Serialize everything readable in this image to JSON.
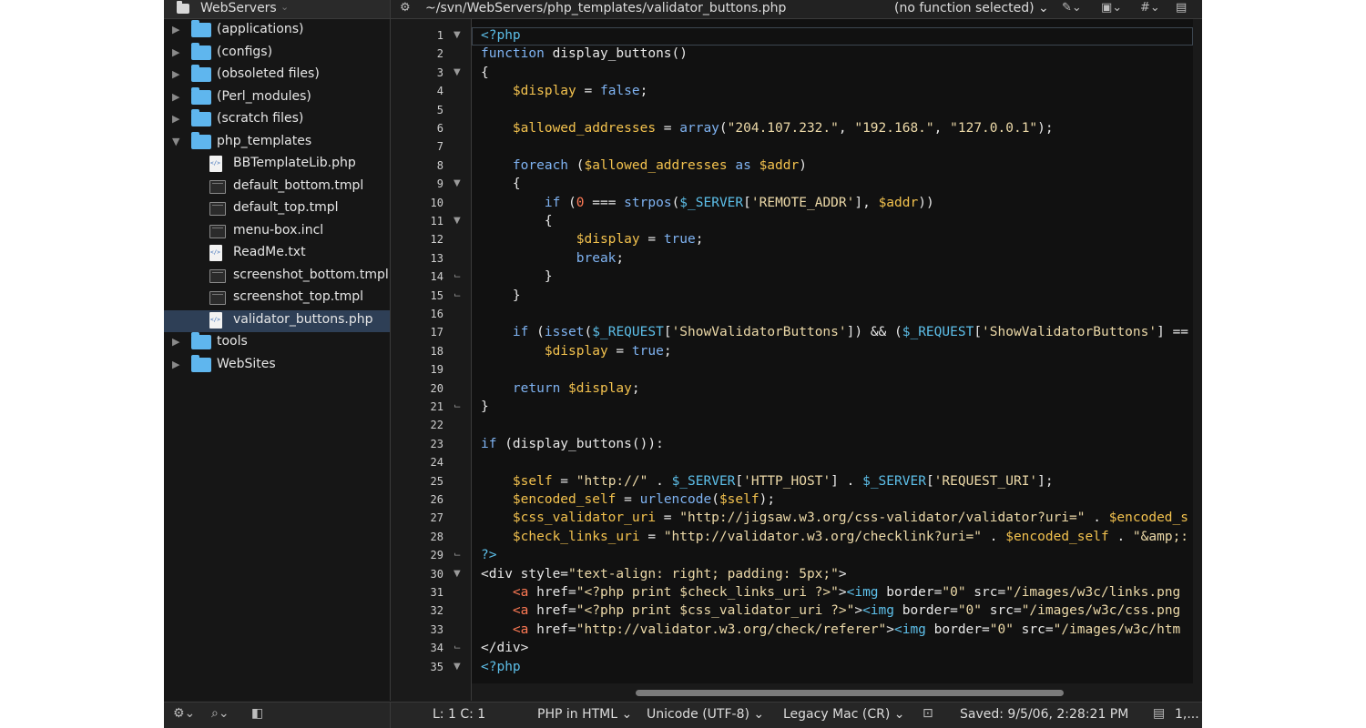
{
  "sidebar": {
    "title": "WebServers",
    "items": [
      {
        "label": "(applications)",
        "kind": "folder",
        "expanded": false,
        "depth": 0
      },
      {
        "label": "(configs)",
        "kind": "folder",
        "expanded": false,
        "depth": 0
      },
      {
        "label": "(obsoleted files)",
        "kind": "folder",
        "expanded": false,
        "depth": 0
      },
      {
        "label": "(Perl_modules)",
        "kind": "folder",
        "expanded": false,
        "depth": 0
      },
      {
        "label": "(scratch files)",
        "kind": "folder",
        "expanded": false,
        "depth": 0
      },
      {
        "label": "php_templates",
        "kind": "folder",
        "expanded": true,
        "depth": 0
      },
      {
        "label": "BBTemplateLib.php",
        "kind": "doc",
        "depth": 1
      },
      {
        "label": "default_bottom.tmpl",
        "kind": "term",
        "depth": 1
      },
      {
        "label": "default_top.tmpl",
        "kind": "term",
        "depth": 1
      },
      {
        "label": "menu-box.incl",
        "kind": "term",
        "depth": 1
      },
      {
        "label": "ReadMe.txt",
        "kind": "doc",
        "depth": 1
      },
      {
        "label": "screenshot_bottom.tmpl",
        "kind": "term",
        "depth": 1
      },
      {
        "label": "screenshot_top.tmpl",
        "kind": "term",
        "depth": 1
      },
      {
        "label": "validator_buttons.php",
        "kind": "doc",
        "depth": 1,
        "selected": true
      },
      {
        "label": "tools",
        "kind": "folder",
        "expanded": false,
        "depth": 0
      },
      {
        "label": "WebSites",
        "kind": "folder",
        "expanded": false,
        "depth": 0
      }
    ]
  },
  "pathbar": {
    "path": "~/svn/WebServers/php_templates/validator_buttons.php",
    "function_menu": "(no function selected) ⌄"
  },
  "editor": {
    "fold_markers": {
      "1": "down",
      "3": "down",
      "9": "down",
      "11": "down",
      "14": "end",
      "15": "end",
      "21": "end",
      "29": "end",
      "30": "down",
      "34": "end",
      "35": "down"
    },
    "lines": [
      [
        [
          "<?php",
          "ph"
        ]
      ],
      [
        [
          "function ",
          "k"
        ],
        [
          "display_buttons()",
          ""
        ]
      ],
      [
        [
          "{",
          ""
        ]
      ],
      [
        [
          "    ",
          ""
        ],
        [
          "$display",
          "v"
        ],
        [
          " = ",
          ""
        ],
        [
          "false",
          "k"
        ],
        [
          ";",
          ""
        ]
      ],
      [],
      [
        [
          "    ",
          ""
        ],
        [
          "$allowed_addresses",
          "v"
        ],
        [
          " = ",
          ""
        ],
        [
          "array",
          "k"
        ],
        [
          "(",
          ""
        ],
        [
          "\"204.107.232.\"",
          "s"
        ],
        [
          ", ",
          ""
        ],
        [
          "\"192.168.\"",
          "s"
        ],
        [
          ", ",
          ""
        ],
        [
          "\"127.0.0.1\"",
          "s"
        ],
        [
          ");",
          ""
        ]
      ],
      [],
      [
        [
          "    ",
          ""
        ],
        [
          "foreach",
          "k"
        ],
        [
          " (",
          ""
        ],
        [
          "$allowed_addresses",
          "v"
        ],
        [
          " ",
          ""
        ],
        [
          "as",
          "k"
        ],
        [
          " ",
          ""
        ],
        [
          "$addr",
          "v"
        ],
        [
          ")",
          ""
        ]
      ],
      [
        [
          "    {",
          ""
        ]
      ],
      [
        [
          "        ",
          ""
        ],
        [
          "if",
          "k"
        ],
        [
          " (",
          ""
        ],
        [
          "0",
          "n"
        ],
        [
          " === ",
          ""
        ],
        [
          "strpos",
          "k"
        ],
        [
          "(",
          ""
        ],
        [
          "$_SERVER",
          "c"
        ],
        [
          "[",
          ""
        ],
        [
          "'REMOTE_ADDR'",
          "s"
        ],
        [
          "], ",
          ""
        ],
        [
          "$addr",
          "v"
        ],
        [
          "))",
          ""
        ]
      ],
      [
        [
          "        {",
          ""
        ]
      ],
      [
        [
          "            ",
          ""
        ],
        [
          "$display",
          "v"
        ],
        [
          " = ",
          ""
        ],
        [
          "true",
          "k"
        ],
        [
          ";",
          ""
        ]
      ],
      [
        [
          "            ",
          ""
        ],
        [
          "break",
          "k"
        ],
        [
          ";",
          ""
        ]
      ],
      [
        [
          "        }",
          ""
        ]
      ],
      [
        [
          "    }",
          ""
        ]
      ],
      [],
      [
        [
          "    ",
          ""
        ],
        [
          "if",
          "k"
        ],
        [
          " (",
          ""
        ],
        [
          "isset",
          "k"
        ],
        [
          "(",
          ""
        ],
        [
          "$_REQUEST",
          "c"
        ],
        [
          "[",
          ""
        ],
        [
          "'ShowValidatorButtons'",
          "s"
        ],
        [
          "]) && (",
          ""
        ],
        [
          "$_REQUEST",
          "c"
        ],
        [
          "[",
          ""
        ],
        [
          "'ShowValidatorButtons'",
          "s"
        ],
        [
          "] ==",
          ""
        ]
      ],
      [
        [
          "        ",
          ""
        ],
        [
          "$display",
          "v"
        ],
        [
          " = ",
          ""
        ],
        [
          "true",
          "k"
        ],
        [
          ";",
          ""
        ]
      ],
      [],
      [
        [
          "    ",
          ""
        ],
        [
          "return",
          "k"
        ],
        [
          " ",
          ""
        ],
        [
          "$display",
          "v"
        ],
        [
          ";",
          ""
        ]
      ],
      [
        [
          "}",
          ""
        ]
      ],
      [],
      [
        [
          "if",
          "k"
        ],
        [
          " (display_buttons()):",
          ""
        ]
      ],
      [],
      [
        [
          "    ",
          ""
        ],
        [
          "$self",
          "v"
        ],
        [
          " = ",
          ""
        ],
        [
          "\"http://\"",
          "s"
        ],
        [
          " . ",
          ""
        ],
        [
          "$_SERVER",
          "c"
        ],
        [
          "[",
          ""
        ],
        [
          "'HTTP_HOST'",
          "s"
        ],
        [
          "] . ",
          ""
        ],
        [
          "$_SERVER",
          "c"
        ],
        [
          "[",
          ""
        ],
        [
          "'REQUEST_URI'",
          "s"
        ],
        [
          "];",
          ""
        ]
      ],
      [
        [
          "    ",
          ""
        ],
        [
          "$encoded_self",
          "v"
        ],
        [
          " = ",
          ""
        ],
        [
          "urlencode",
          "k"
        ],
        [
          "(",
          ""
        ],
        [
          "$self",
          "v"
        ],
        [
          ");",
          ""
        ]
      ],
      [
        [
          "    ",
          ""
        ],
        [
          "$css_validator_uri",
          "v"
        ],
        [
          " = ",
          ""
        ],
        [
          "\"http://jigsaw.w3.org/css-validator/validator?uri=\"",
          "s"
        ],
        [
          " . ",
          ""
        ],
        [
          "$encoded_s",
          "v"
        ]
      ],
      [
        [
          "    ",
          ""
        ],
        [
          "$check_links_uri",
          "v"
        ],
        [
          " = ",
          ""
        ],
        [
          "\"http://validator.w3.org/checklink?uri=\"",
          "s"
        ],
        [
          " . ",
          ""
        ],
        [
          "$encoded_self",
          "v"
        ],
        [
          " . ",
          ""
        ],
        [
          "\"&amp;:",
          "s"
        ]
      ],
      [
        [
          "?>",
          "ph"
        ]
      ],
      [
        [
          "<div ",
          ""
        ],
        [
          "style=",
          ""
        ],
        [
          "\"text-align: right; padding: 5px;\"",
          "s"
        ],
        [
          ">",
          ""
        ]
      ],
      [
        [
          "    ",
          ""
        ],
        [
          "<a",
          "t"
        ],
        [
          " href=",
          ""
        ],
        [
          "\"<?php print $check_links_uri ?>\"",
          "s"
        ],
        [
          ">",
          ""
        ],
        [
          "<img",
          "c"
        ],
        [
          " border=",
          ""
        ],
        [
          "\"0\"",
          "s"
        ],
        [
          " src=",
          ""
        ],
        [
          "\"/images/w3c/links.png",
          "s"
        ]
      ],
      [
        [
          "    ",
          ""
        ],
        [
          "<a",
          "t"
        ],
        [
          " href=",
          ""
        ],
        [
          "\"<?php print $css_validator_uri ?>\"",
          "s"
        ],
        [
          ">",
          ""
        ],
        [
          "<img",
          "c"
        ],
        [
          " border=",
          ""
        ],
        [
          "\"0\"",
          "s"
        ],
        [
          " src=",
          ""
        ],
        [
          "\"/images/w3c/css.png",
          "s"
        ]
      ],
      [
        [
          "    ",
          ""
        ],
        [
          "<a",
          "t"
        ],
        [
          " href=",
          ""
        ],
        [
          "\"http://validator.w3.org/check/referer\"",
          "s"
        ],
        [
          ">",
          ""
        ],
        [
          "<img",
          "c"
        ],
        [
          " border=",
          ""
        ],
        [
          "\"0\"",
          "s"
        ],
        [
          " src=",
          ""
        ],
        [
          "\"/images/w3c/htm",
          "s"
        ]
      ],
      [
        [
          "</div>",
          ""
        ]
      ],
      [
        [
          "<?php",
          "ph"
        ]
      ]
    ]
  },
  "status": {
    "position": "L: 1 C: 1",
    "language": "PHP in HTML ⌄",
    "encoding": "Unicode (UTF-8) ⌄",
    "line_endings": "Legacy Mac (CR) ⌄",
    "saved": "Saved: 9/5/06, 2:28:21 PM",
    "extra": "1,..."
  },
  "icons": {
    "gear": "⚙",
    "search": "🔍",
    "pen": "✎",
    "hash": "#",
    "lock": "🔓",
    "doc": "▆"
  }
}
